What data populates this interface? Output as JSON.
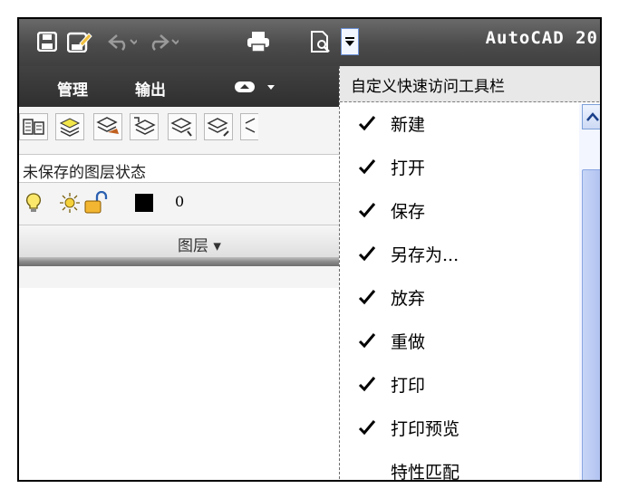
{
  "title_bar": {
    "app_title": "AutoCAD 20"
  },
  "quick_access": {
    "icons": [
      "save-icon",
      "save-as-icon",
      "undo-icon",
      "redo-icon",
      "print-icon",
      "print-preview-icon",
      "qat-dropdown-icon"
    ]
  },
  "ribbon": {
    "tabs": [
      {
        "label": "管理"
      },
      {
        "label": "输出"
      }
    ],
    "layer_state": "未保存的图层状态",
    "current_layer": "0",
    "panel_title": "图层 ▾"
  },
  "qat_menu": {
    "title": "自定义快速访问工具栏",
    "items": [
      {
        "label": "新建",
        "checked": true
      },
      {
        "label": "打开",
        "checked": true
      },
      {
        "label": "保存",
        "checked": true
      },
      {
        "label": "另存为...",
        "checked": true
      },
      {
        "label": "放弃",
        "checked": true
      },
      {
        "label": "重做",
        "checked": true
      },
      {
        "label": "打印",
        "checked": true
      },
      {
        "label": "打印预览",
        "checked": true
      },
      {
        "label": "特性匹配",
        "checked": false
      }
    ]
  },
  "colors": {
    "title_bar": "#4b4b4b",
    "tab_bar": "#333333",
    "menu_accent": "#6a8fd6"
  }
}
